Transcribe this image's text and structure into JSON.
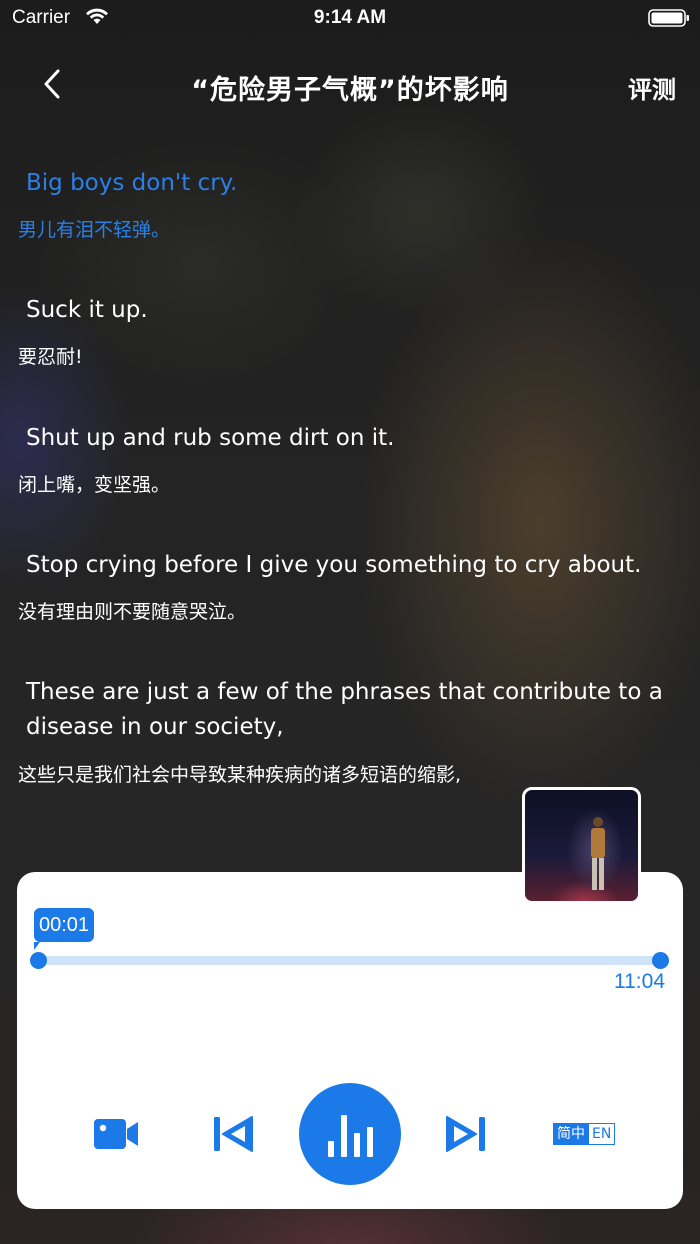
{
  "status_bar": {
    "carrier": "Carrier",
    "time": "9:14 AM"
  },
  "nav": {
    "title": "“危险男子气概”的坏影响",
    "right_button": "评测"
  },
  "subtitles": [
    {
      "en": "Big boys don't cry.",
      "zh": "男儿有泪不轻弹。",
      "active": true
    },
    {
      "en": "Suck it up.",
      "zh": "要忍耐!",
      "active": false
    },
    {
      "en": "Shut up and rub some dirt on it.",
      "zh": "闭上嘴，变坚强。",
      "active": false
    },
    {
      "en": "Stop crying before I give you something to cry about.",
      "zh": "没有理由则不要随意哭泣。",
      "active": false
    },
    {
      "en": "These are just a few of the phrases that contribute to a disease in our society,",
      "zh": "这些只是我们社会中导致某种疾病的诸多短语的缩影,",
      "active": false
    }
  ],
  "player": {
    "current_time": "00:01",
    "duration": "11:04",
    "progress": 0.0015,
    "language": {
      "zh": "简中",
      "en": "EN"
    }
  },
  "colors": {
    "accent": "#1b7ae8",
    "track": "#cfe3fb"
  },
  "icons": [
    "wifi-icon",
    "battery-icon",
    "back-chevron-icon",
    "video-camera-icon",
    "skip-previous-icon",
    "audio-bars-icon",
    "skip-next-icon"
  ]
}
